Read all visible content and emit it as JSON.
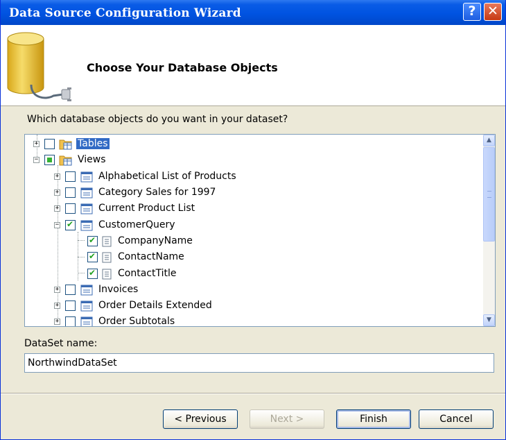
{
  "window": {
    "title": "Data Source Configuration Wizard",
    "help_label": "?",
    "close_label": "✕"
  },
  "header": {
    "title": "Choose Your Database Objects"
  },
  "tree": {
    "question": "Which database objects do you want in your dataset?",
    "nodes": [
      {
        "label": "Tables",
        "expander": "+",
        "check": "unchecked",
        "selected": true
      },
      {
        "label": "Views",
        "expander": "−",
        "check": "partial"
      },
      {
        "label": "Alphabetical List of Products",
        "expander": "+",
        "check": "unchecked"
      },
      {
        "label": "Category Sales for 1997",
        "expander": "+",
        "check": "unchecked"
      },
      {
        "label": "Current Product List",
        "expander": "+",
        "check": "unchecked"
      },
      {
        "label": "CustomerQuery",
        "expander": "−",
        "check": "checked"
      },
      {
        "label": "CompanyName",
        "check": "checked"
      },
      {
        "label": "ContactName",
        "check": "checked"
      },
      {
        "label": "ContactTitle",
        "check": "checked"
      },
      {
        "label": "Invoices",
        "expander": "+",
        "check": "unchecked"
      },
      {
        "label": "Order Details Extended",
        "expander": "+",
        "check": "unchecked"
      },
      {
        "label": "Order Subtotals",
        "expander": "+",
        "check": "unchecked"
      }
    ],
    "scroll_up": "▲",
    "scroll_down": "▼"
  },
  "dataset": {
    "label": "DataSet name:",
    "value": "NorthwindDataSet"
  },
  "buttons": {
    "previous": "< Previous",
    "next": "Next >",
    "finish": "Finish",
    "cancel": "Cancel"
  },
  "colors": {
    "titlebar": "#0053e1",
    "selection": "#316ac5",
    "check_green": "#21a121",
    "dialog_bg": "#ece9d8"
  }
}
